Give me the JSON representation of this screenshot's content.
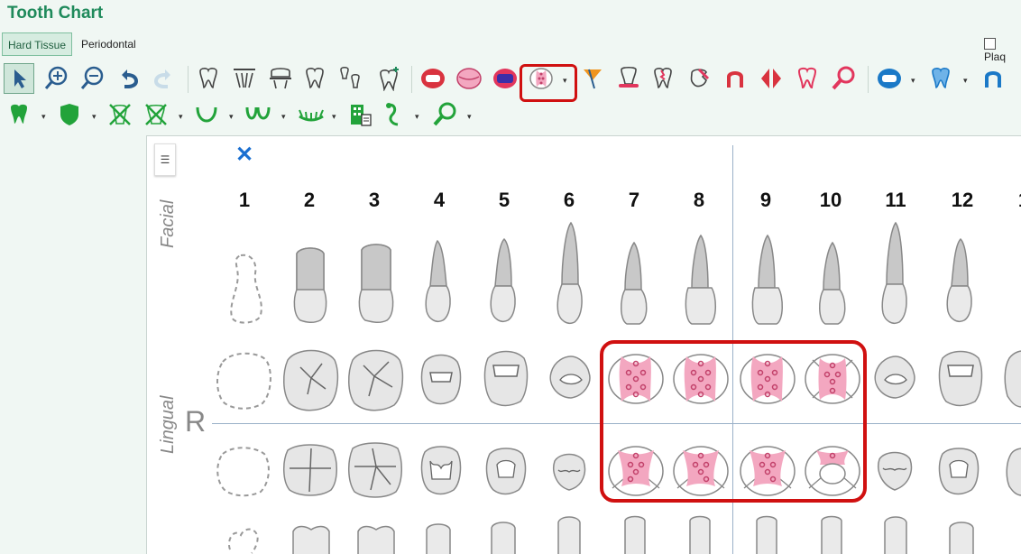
{
  "app": {
    "title": "Tooth Chart"
  },
  "tabs": [
    {
      "label": "Hard Tissue",
      "active": true
    },
    {
      "label": "Periodontal",
      "active": false
    }
  ],
  "plaque": {
    "label": "Plaq"
  },
  "chart": {
    "side_labels": {
      "facial": "Facial",
      "lingual": "Lingual"
    },
    "quadrant_label": "R",
    "tooth_numbers": [
      "1",
      "2",
      "3",
      "4",
      "5",
      "6",
      "7",
      "8",
      "9",
      "10",
      "11",
      "12",
      "1"
    ],
    "selected_teeth": [
      "7",
      "8",
      "9",
      "10"
    ]
  },
  "colors": {
    "accent": "#1f8a5b",
    "highlight": "#d01010",
    "pink": "#f3a7c0"
  }
}
